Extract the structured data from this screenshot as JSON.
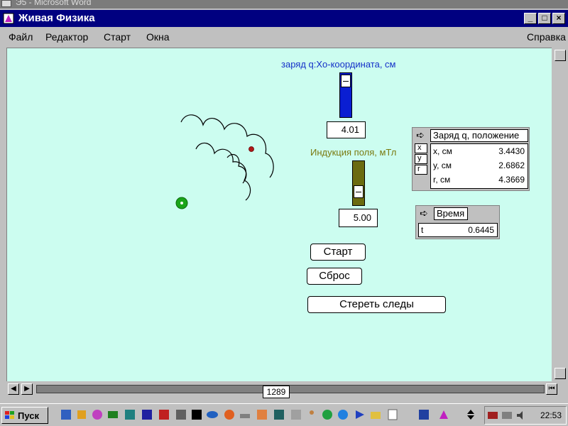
{
  "behind_window": {
    "title": "Э5 - Microsoft Word"
  },
  "window": {
    "title": "Живая Физика"
  },
  "menu": {
    "items": [
      "Файл",
      "Редактор",
      "Старт",
      "Окна"
    ],
    "help": "Справка"
  },
  "controls": {
    "charge_slider": {
      "label": "заряд q:Xo-координата, см",
      "value": "4.01"
    },
    "induction_slider": {
      "label": "Индукция поля, мТл",
      "value": "5.00"
    }
  },
  "position_panel": {
    "title": "Заряд q, положение",
    "tags": [
      "x",
      "y",
      "r"
    ],
    "rows": [
      {
        "key": "x, см",
        "value": "3.4430"
      },
      {
        "key": "y, см",
        "value": "2.6862"
      },
      {
        "key": "r, см",
        "value": "4.3669"
      }
    ]
  },
  "time_panel": {
    "title": "Время",
    "row": {
      "key": "t",
      "value": "0.6445"
    }
  },
  "buttons": {
    "start": "Старт",
    "reset": "Сброс",
    "clear": "Стереть следы"
  },
  "hscroll": {
    "frame": "1289"
  },
  "taskbar": {
    "start": "Пуск",
    "clock": "22:53"
  },
  "colors": {
    "canvas": "#ccfdf0",
    "title_bar": "#000080",
    "slider_blue": "#0a1ed2",
    "slider_olive": "#6b6b10",
    "charge": "#b01818",
    "body": "#1aa51a"
  }
}
